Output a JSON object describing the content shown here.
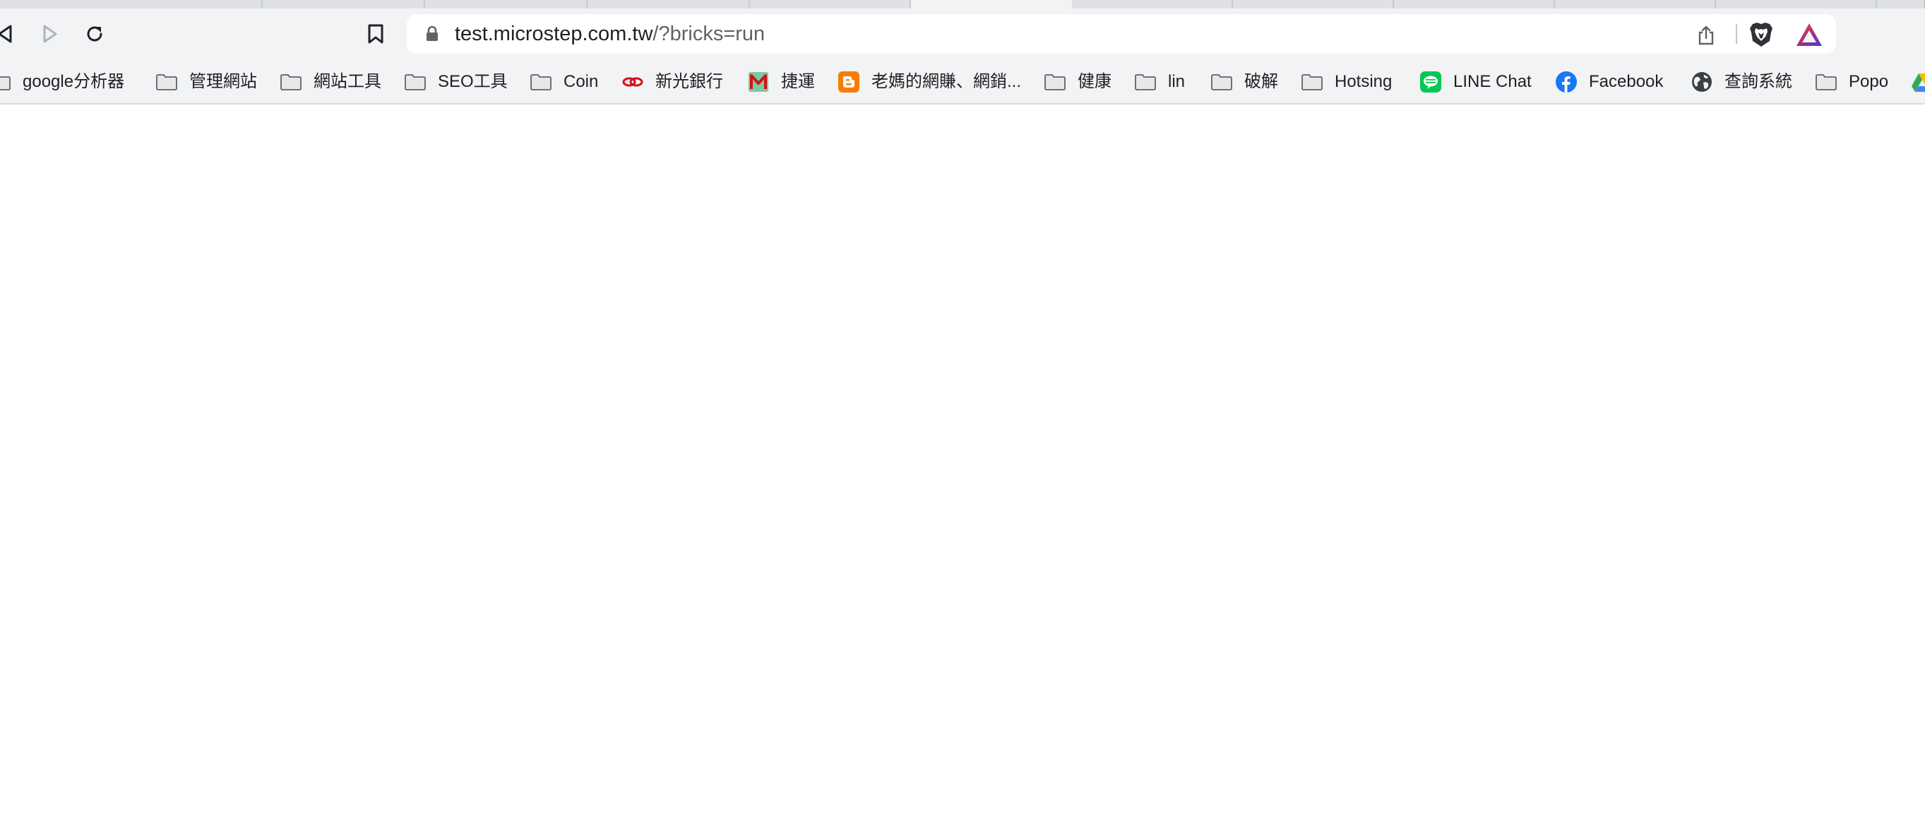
{
  "browser": {
    "url": {
      "host": "test.microstep.com.tw",
      "path": "/?bricks=run"
    }
  },
  "bookmarks": [
    {
      "label": "google分析器",
      "icon": "folder-icon"
    },
    {
      "label": "管理網站",
      "icon": "folder-icon"
    },
    {
      "label": "網站工具",
      "icon": "folder-icon"
    },
    {
      "label": "SEO工具",
      "icon": "folder-icon"
    },
    {
      "label": "Coin",
      "icon": "folder-icon"
    },
    {
      "label": "新光銀行",
      "icon": "skbank-icon"
    },
    {
      "label": "捷運",
      "icon": "metro-icon"
    },
    {
      "label": "老媽的網賺、網銷...",
      "icon": "blogger-icon"
    },
    {
      "label": "健康",
      "icon": "folder-icon"
    },
    {
      "label": "lin",
      "icon": "folder-icon"
    },
    {
      "label": "破解",
      "icon": "folder-icon"
    },
    {
      "label": "Hotsing",
      "icon": "folder-icon"
    },
    {
      "label": "LINE Chat",
      "icon": "line-icon"
    },
    {
      "label": "Facebook",
      "icon": "facebook-icon"
    },
    {
      "label": "查詢系統",
      "icon": "globe-icon"
    },
    {
      "label": "Popo",
      "icon": "folder-icon"
    }
  ],
  "colors": {
    "chrome_bg": "#f1f3f4",
    "line_green": "#06c755",
    "facebook_blue": "#1877f2",
    "blogger_orange": "#f57d00",
    "brave_orange": "#fb542b"
  }
}
